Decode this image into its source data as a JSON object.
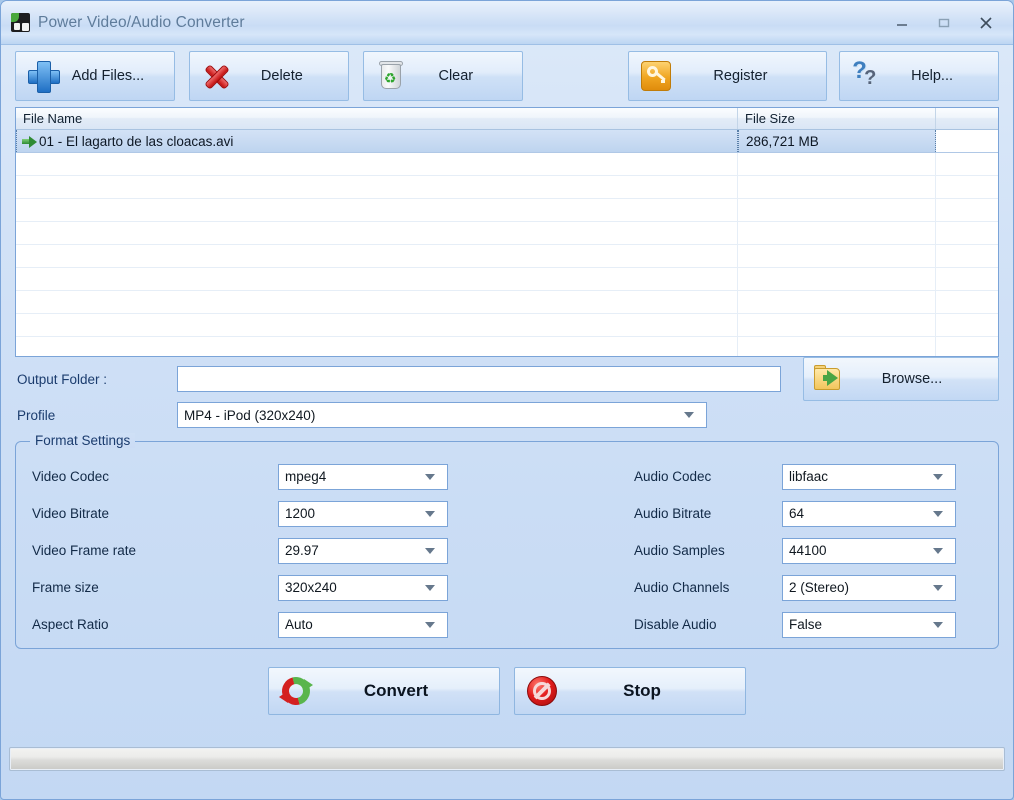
{
  "window": {
    "title": "Power Video/Audio Converter",
    "app_icon": "app-icon",
    "controls": {
      "minimize": "minimize-icon",
      "maximize": "maximize-icon",
      "close": "close-icon"
    }
  },
  "toolbar": {
    "add_files": "Add Files...",
    "delete": "Delete",
    "clear": "Clear",
    "register": "Register",
    "help": "Help..."
  },
  "file_list": {
    "columns": [
      "File Name",
      "File Size",
      ""
    ],
    "rows": [
      {
        "name": "01 - El lagarto de las cloacas.avi",
        "size": "286,721 MB",
        "selected": true
      }
    ]
  },
  "output": {
    "folder_label": "Output Folder :",
    "folder_value": "",
    "folder_placeholder": "",
    "browse_label": "Browse...",
    "profile_label": "Profile",
    "profile_value": "MP4 - iPod (320x240)"
  },
  "format_settings": {
    "title": "Format Settings",
    "left": [
      {
        "label": "Video Codec",
        "value": "mpeg4"
      },
      {
        "label": "Video Bitrate",
        "value": "1200"
      },
      {
        "label": "Video Frame rate",
        "value": "29.97"
      },
      {
        "label": "Frame size",
        "value": "320x240"
      },
      {
        "label": "Aspect Ratio",
        "value": "Auto"
      }
    ],
    "right": [
      {
        "label": "Audio Codec",
        "value": "libfaac"
      },
      {
        "label": "Audio Bitrate",
        "value": "64"
      },
      {
        "label": "Audio Samples",
        "value": "44100"
      },
      {
        "label": "Audio Channels",
        "value": "2 (Stereo)"
      },
      {
        "label": "Disable Audio",
        "value": "False"
      }
    ]
  },
  "actions": {
    "convert": "Convert",
    "stop": "Stop"
  },
  "status": {
    "progress_percent": 0,
    "text": ""
  },
  "colors": {
    "window_bg": "#cfe0f6",
    "frame_border": "#7ba4d8",
    "title_text": "#5f7c9b",
    "label_text": "#1b3c6e",
    "selection": "#bed4ef"
  }
}
